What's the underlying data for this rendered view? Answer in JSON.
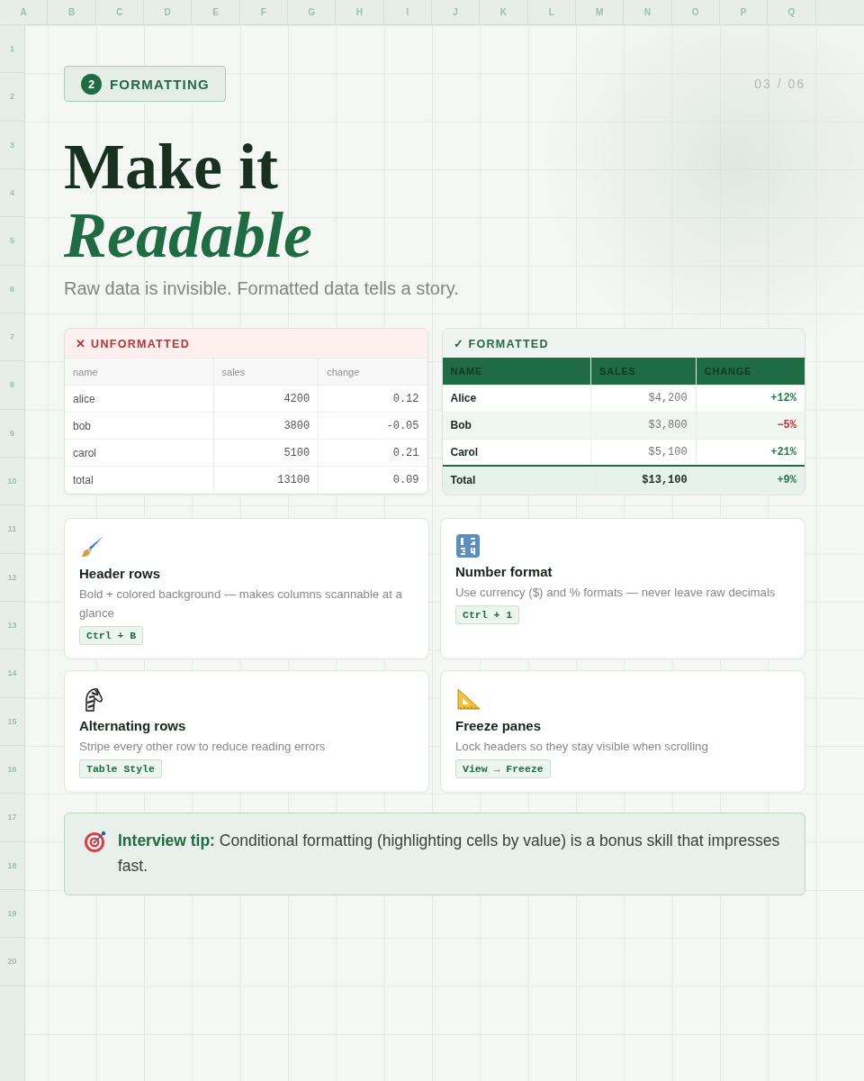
{
  "column_headers": [
    "A",
    "B",
    "C",
    "D",
    "E",
    "F",
    "G",
    "H",
    "I",
    "J",
    "K",
    "L",
    "M",
    "N",
    "O",
    "P",
    "Q"
  ],
  "row_headers": [
    "1",
    "2",
    "3",
    "4",
    "5",
    "6",
    "7",
    "8",
    "9",
    "10",
    "11",
    "12",
    "13",
    "14",
    "15",
    "16",
    "17",
    "18",
    "19",
    "20"
  ],
  "badge": {
    "number": "2",
    "label": "FORMATTING"
  },
  "page_counter": "03 / 06",
  "title": {
    "line1": "Make it",
    "line2": "Readable"
  },
  "subtitle": "Raw data is invisible. Formatted data tells a story.",
  "unformatted_table": {
    "label": "✕ UNFORMATTED",
    "columns": [
      "name",
      "sales",
      "change"
    ],
    "rows": [
      {
        "name": "alice",
        "sales": "4200",
        "change": "0.12"
      },
      {
        "name": "bob",
        "sales": "3800",
        "change": "-0.05"
      },
      {
        "name": "carol",
        "sales": "5100",
        "change": "0.21"
      },
      {
        "name": "total",
        "sales": "13100",
        "change": "0.09"
      }
    ]
  },
  "formatted_table": {
    "label": "✓ FORMATTED",
    "columns": [
      "NAME",
      "SALES",
      "CHANGE"
    ],
    "rows": [
      {
        "name": "Alice",
        "sales": "$4,200",
        "change": "+12%",
        "negative": false
      },
      {
        "name": "Bob",
        "sales": "$3,800",
        "change": "−5%",
        "negative": true
      },
      {
        "name": "Carol",
        "sales": "$5,100",
        "change": "+21%",
        "negative": false
      }
    ],
    "total": {
      "name": "Total",
      "sales": "$13,100",
      "change": "+9%",
      "negative": false
    }
  },
  "tips": [
    {
      "title": "Header rows",
      "description": "Bold + colored background — makes columns scannable at a glance",
      "shortcut": "Ctrl + B"
    },
    {
      "title": "Number format",
      "description": "Use currency ($) and % formats — never leave raw decimals",
      "shortcut": "Ctrl + 1"
    },
    {
      "title": "Alternating rows",
      "description": "Stripe every other row to reduce reading errors",
      "shortcut": "Table Style"
    },
    {
      "title": "Freeze panes",
      "description": "Lock headers so they stay visible when scrolling",
      "shortcut": "View → Freeze"
    }
  ],
  "interview_tip": {
    "text": "**Interview tip:** Conditional formatting (highlighting cells by value) is a bonus skill that impresses fast."
  }
}
